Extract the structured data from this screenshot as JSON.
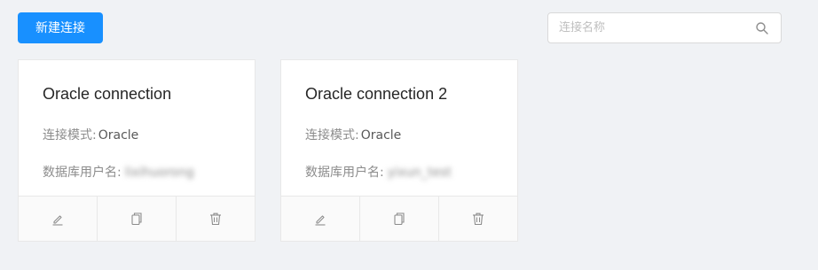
{
  "toolbar": {
    "new_connection_label": "新建连接"
  },
  "search": {
    "placeholder": "连接名称",
    "value": ""
  },
  "cards": [
    {
      "title": "Oracle connection",
      "mode_label": "连接模式:",
      "mode_value": "Oracle",
      "user_label": "数据库用户名:",
      "user_value": "lixihuorong"
    },
    {
      "title": "Oracle connection 2",
      "mode_label": "连接模式:",
      "mode_value": "Oracle",
      "user_label": "数据库用户名:",
      "user_value": "yixun_test"
    }
  ],
  "icons": {
    "edit": "edit-icon",
    "copy": "copy-icon",
    "delete": "trash-icon",
    "search": "search-icon"
  },
  "colors": {
    "primary": "#1890ff",
    "background": "#f0f2f5"
  }
}
